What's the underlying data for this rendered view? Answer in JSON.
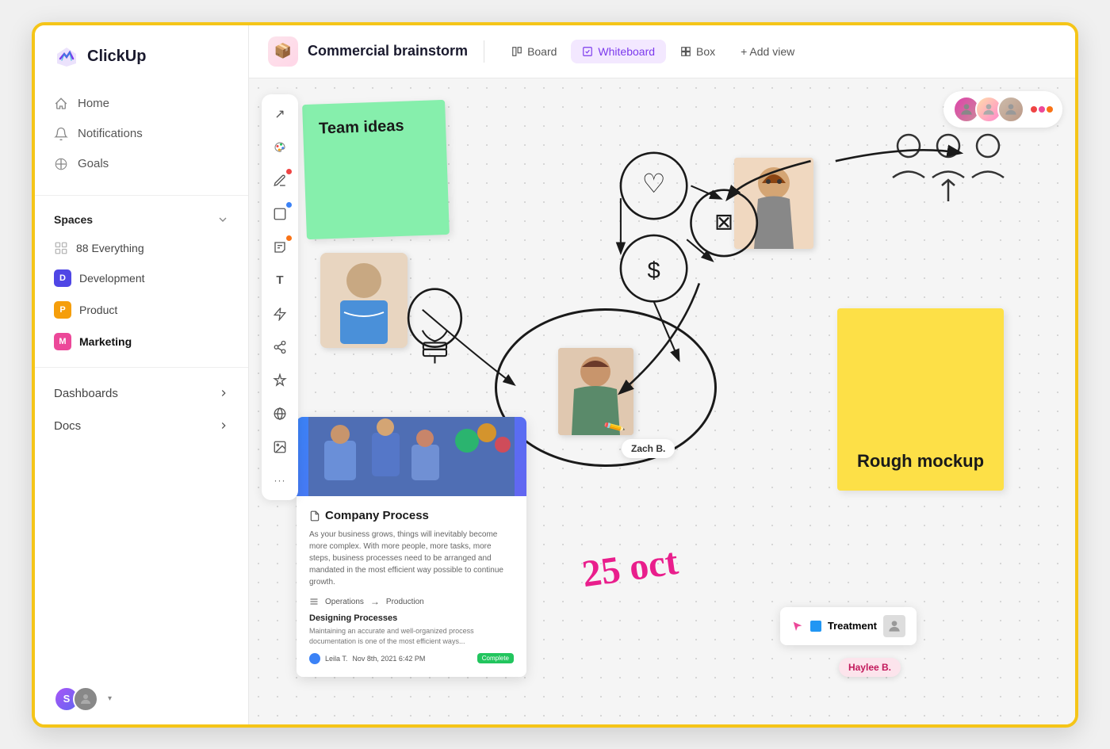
{
  "app": {
    "name": "ClickUp"
  },
  "sidebar": {
    "logo": "ClickUp",
    "nav": [
      {
        "id": "home",
        "label": "Home",
        "icon": "🏠"
      },
      {
        "id": "notifications",
        "label": "Notifications",
        "icon": "🔔"
      },
      {
        "id": "goals",
        "label": "Goals",
        "icon": "🏆"
      }
    ],
    "spaces": {
      "label": "Spaces",
      "items": [
        {
          "id": "everything",
          "label": "Everything",
          "count": "88"
        },
        {
          "id": "development",
          "label": "Development",
          "badge_color": "#4f46e5",
          "badge_letter": "D"
        },
        {
          "id": "product",
          "label": "Product",
          "badge_color": "#f59e0b",
          "badge_letter": "P"
        },
        {
          "id": "marketing",
          "label": "Marketing",
          "badge_color": "#ec4899",
          "badge_letter": "M",
          "bold": true
        }
      ]
    },
    "sections": [
      {
        "id": "dashboards",
        "label": "Dashboards"
      },
      {
        "id": "docs",
        "label": "Docs"
      }
    ]
  },
  "toolbar": {
    "title": "Commercial brainstorm",
    "title_icon": "📦",
    "tabs": [
      {
        "id": "whiteboard",
        "label": "Whiteboard",
        "active": true,
        "icon": "✏️"
      },
      {
        "id": "board",
        "label": "Board",
        "icon": "▦"
      },
      {
        "id": "box",
        "label": "Box",
        "icon": "⊞"
      }
    ],
    "add_view_label": "+ Add view"
  },
  "whiteboard": {
    "sticky_green": {
      "text": "Team ideas"
    },
    "sticky_yellow": {
      "text": "Rough mockup"
    },
    "date_annotation": "25 oct",
    "doc_card": {
      "title": "Company Process",
      "body_text": "As your business grows, things will inevitably become more complex. With more people, more tasks, more steps, business processes need to be arranged and mandated in the most efficient way possible to continue growth.",
      "arrow_from": "Operations",
      "arrow_to": "Production",
      "sub_title": "Designing Processes",
      "sub_text": "Maintaining an accurate and well-organized process documentation is one of the most efficient ways...",
      "author": "Leila T.",
      "date": "Nov 8th, 2021 6:42 PM",
      "status": "Complete"
    },
    "name_tags": [
      {
        "id": "zach",
        "label": "Zach B.",
        "style": "normal"
      },
      {
        "id": "haylee",
        "label": "Haylee B.",
        "style": "pink"
      }
    ],
    "treatment": {
      "label": "Treatment"
    },
    "collaborators": [
      {
        "id": "c1",
        "color": "#ccc"
      },
      {
        "id": "c2",
        "color": "#f8a"
      },
      {
        "id": "c3",
        "color": "#c8a"
      }
    ],
    "collab_dots": [
      {
        "color": "#ef4444"
      },
      {
        "color": "#ec4899"
      },
      {
        "color": "#f97316"
      }
    ]
  },
  "tools": [
    {
      "id": "pointer",
      "icon": "↗",
      "dot": null
    },
    {
      "id": "palette",
      "icon": "🎨",
      "dot": null
    },
    {
      "id": "pen",
      "icon": "✏️",
      "dot": "red"
    },
    {
      "id": "square",
      "icon": "□",
      "dot": "blue"
    },
    {
      "id": "sticky",
      "icon": "📝",
      "dot": "orange"
    },
    {
      "id": "text",
      "icon": "T",
      "dot": null
    },
    {
      "id": "lightning",
      "icon": "⚡",
      "dot": null
    },
    {
      "id": "share",
      "icon": "⎇",
      "dot": null
    },
    {
      "id": "star",
      "icon": "✦",
      "dot": null
    },
    {
      "id": "globe",
      "icon": "🌐",
      "dot": null
    },
    {
      "id": "image",
      "icon": "🖼️",
      "dot": null
    },
    {
      "id": "more",
      "icon": "•••",
      "dot": null
    }
  ]
}
